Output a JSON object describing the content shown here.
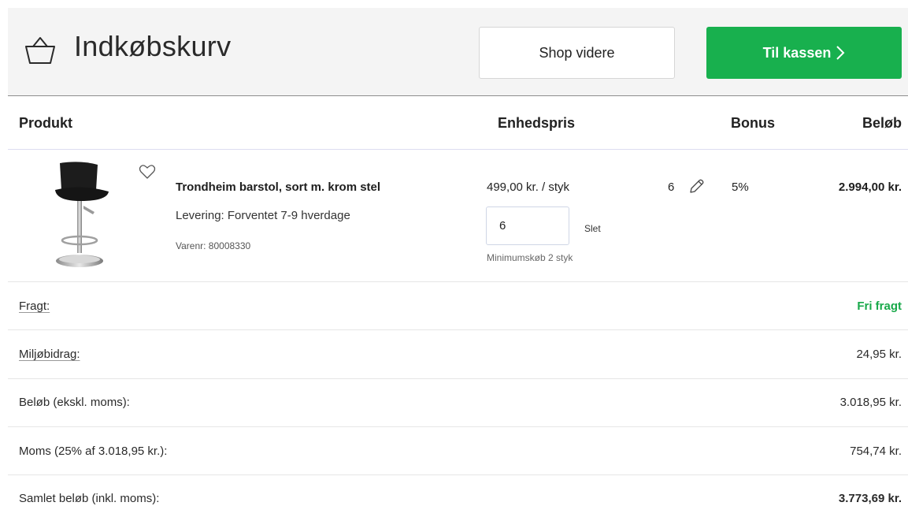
{
  "header": {
    "title": "Indkøbskurv",
    "shop_button": "Shop videre",
    "checkout_button": "Til kassen",
    "checkout_color": "#18b04e"
  },
  "columns": {
    "product": "Produkt",
    "unit_price": "Enhedspris",
    "bonus": "Bonus",
    "amount": "Beløb"
  },
  "item": {
    "name": "Trondheim barstol, sort m. krom stel",
    "delivery": "Levering: Forventet 7-9 hverdage",
    "sku": "Varenr: 80008330",
    "unit_price": "499,00 kr. / styk",
    "quantity_value": "6",
    "delete_label": "Slet",
    "min_note": "Minimumskøb 2 styk",
    "quantity_display": "6",
    "bonus": "5%",
    "total": "2.994,00 kr."
  },
  "summary": {
    "freight_label": "Fragt:",
    "freight_value": "Fri fragt",
    "env_label": "Miljøbidrag:",
    "env_value": "24,95 kr.",
    "ex_vat_label": "Beløb (ekskl. moms):",
    "ex_vat_value": "3.018,95 kr.",
    "vat_label": "Moms (25% af 3.018,95 kr.):",
    "vat_value": "754,74 kr.",
    "total_label": "Samlet beløb (inkl. moms):",
    "total_value": "3.773,69 kr."
  },
  "icons": {
    "basket": "basket-icon",
    "chevron": "chevron-right-icon",
    "heart": "heart-icon",
    "pencil": "pencil-icon"
  }
}
